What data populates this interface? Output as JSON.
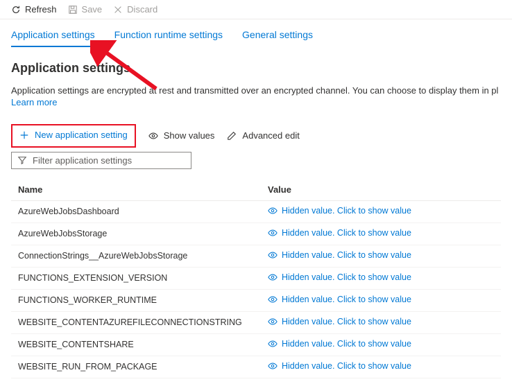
{
  "toolbar": {
    "refresh": "Refresh",
    "save": "Save",
    "discard": "Discard"
  },
  "tabs": {
    "app_settings": "Application settings",
    "runtime_settings": "Function runtime settings",
    "general_settings": "General settings"
  },
  "heading": "Application settings",
  "description": "Application settings are encrypted at rest and transmitted over an encrypted channel. You can choose to display them in pl",
  "learn_more": "Learn more",
  "actions": {
    "new_setting": "New application setting",
    "show_values": "Show values",
    "advanced_edit": "Advanced edit"
  },
  "filter_placeholder": "Filter application settings",
  "table": {
    "col_name": "Name",
    "col_value": "Value",
    "hidden_text": "Hidden value. Click to show value",
    "rows": [
      {
        "name": "AzureWebJobsDashboard"
      },
      {
        "name": "AzureWebJobsStorage"
      },
      {
        "name": "ConnectionStrings__AzureWebJobsStorage"
      },
      {
        "name": "FUNCTIONS_EXTENSION_VERSION"
      },
      {
        "name": "FUNCTIONS_WORKER_RUNTIME"
      },
      {
        "name": "WEBSITE_CONTENTAZUREFILECONNECTIONSTRING"
      },
      {
        "name": "WEBSITE_CONTENTSHARE"
      },
      {
        "name": "WEBSITE_RUN_FROM_PACKAGE"
      }
    ]
  }
}
